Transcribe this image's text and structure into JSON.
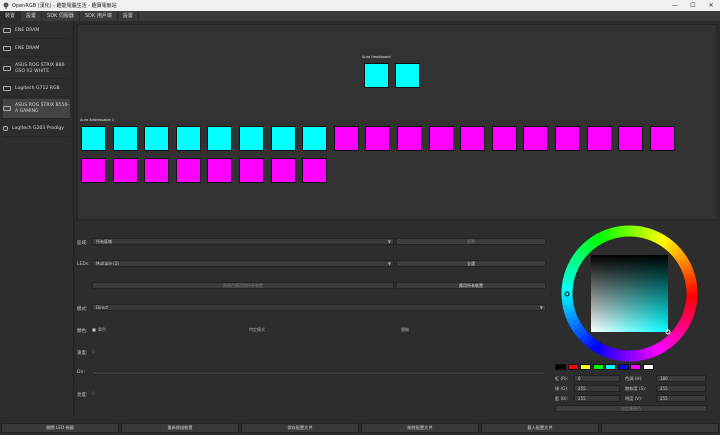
{
  "window": {
    "title": "OpenRGB (漢化) - 趣能電腦生活 - 趣寶電競站",
    "minimize": "—",
    "maximize": "☐",
    "close": "✕"
  },
  "tabs": [
    "裝置",
    "設置",
    "SDK 伺服器",
    "SDK 用戶端",
    "設置"
  ],
  "devices": [
    {
      "label": "ENE DRAM"
    },
    {
      "label": "ENE DRAM"
    },
    {
      "label": "ASUS ROG STRIX B86 GSO X2 WHITE"
    },
    {
      "label": "Logitech G712 RGB"
    },
    {
      "label": "ASUS ROG STRIX B550-A GAMING"
    },
    {
      "label": "Logitech G203 Prodigy"
    }
  ],
  "zones": {
    "headboard_label": "Aura Headboard",
    "addressable_label": "Aura Addressable 1",
    "headboard_leds": [
      "#00ffff",
      "#00ffff"
    ],
    "addressable_leds": [
      "#00ffff",
      "#00ffff",
      "#00ffff",
      "#00ffff",
      "#00ffff",
      "#00ffff",
      "#00ffff",
      "#00ffff",
      "#ff00ff",
      "#ff00ff",
      "#ff00ff",
      "#ff00ff",
      "#ff00ff",
      "#ff00ff",
      "#ff00ff",
      "#ff00ff",
      "#ff00ff",
      "#ff00ff",
      "#ff00ff",
      "#ff00ff",
      "#ff00ff",
      "#ff00ff",
      "#ff00ff",
      "#ff00ff",
      "#ff00ff",
      "#ff00ff",
      "#ff00ff",
      "#ff00ff",
      "#ff00ff",
      "#ff00ff",
      "#ff00ff",
      "#ff00ff",
      "#ff00ff",
      "#ff00ff",
      "#ff00ff",
      "#ff00ff",
      "#ff00ff",
      "#ff00ff",
      "#ff00ff",
      "#ff00ff",
      "#ff00ff",
      "#ff00ff",
      "#ff00ff",
      "#ff00ff",
      "#ff00ff",
      "#ff00ff",
      "#ff00ff",
      "#ff00ff",
      "#ff00ff",
      "#ff00ff",
      "#ff00ff",
      "#ff00ff",
      "#ff00ff",
      "#ff00ff",
      "#ff00ff",
      "#ff00ff",
      "#ff00ff",
      "#ff00ff",
      "#ff00ff",
      "#ff00ff",
      "#ff00ff",
      "#ff00ff",
      "#ff00ff",
      "#ff00ff",
      "#ff00ff",
      "#ff00ff",
      "#ff00ff",
      "#ff00ff",
      "#ff00ff",
      "#ff00ff",
      "#ff00ff",
      "#ff00ff",
      "#ff00ff",
      "#ff00ff",
      "#ff00ff",
      "#ff00ff",
      "#ff00ff",
      "#ff00ff",
      "#ff00ff",
      "#ff00ff",
      "#ff00ff"
    ]
  },
  "controls": {
    "zone_label": "區域:",
    "zone_value": "所有區域",
    "resize_button": "調整",
    "leds_label": "LEDs:",
    "leds_value": "Multiple (2)",
    "select_all_button": "全選",
    "apply_all_devices_button": "將顏色應用到所有裝置",
    "apply_selected_button": "應用所有裝置",
    "mode_label": "模式:",
    "mode_value": "Direct",
    "color_label": "顏色:",
    "color_options": [
      "單色",
      "特定模式",
      "隨機"
    ],
    "speed_label": "速度:",
    "speed_value": "0",
    "dir_label": "Dir:",
    "brightness_label": "亮度:",
    "brightness_value": "0"
  },
  "color_picker": {
    "swatches": [
      "#000000",
      "#ff0000",
      "#ffff00",
      "#00ff00",
      "#00ffff",
      "#0000ff",
      "#ff00ff",
      "#ffffff"
    ],
    "r_label": "紅 (R):",
    "r_value": "0",
    "g_label": "綠 (G):",
    "g_value": "255",
    "b_label": "藍 (B):",
    "b_value": "255",
    "h_label": "色調 (H):",
    "h_value": "180",
    "s_label": "飽和度 (S):",
    "s_value": "255",
    "v_label": "明度 (V):",
    "v_value": "255",
    "custom_button": "自定義顏色"
  },
  "bottom_buttons": [
    "開關 LED 視圖",
    "重新掃描裝置",
    "保存配置文件",
    "刪除配置文件",
    "載入配置文件",
    ""
  ]
}
